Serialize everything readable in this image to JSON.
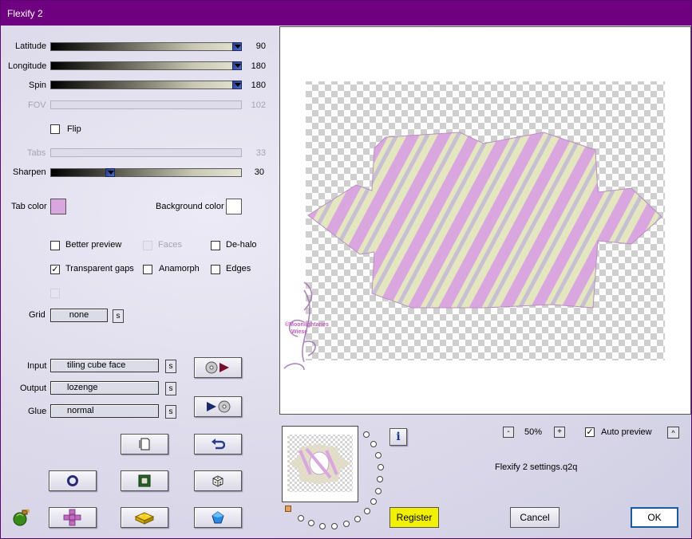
{
  "window": {
    "title": "Flexify 2"
  },
  "sliders": [
    {
      "label": "Latitude",
      "value": "90",
      "disabled": false,
      "level": 1.0
    },
    {
      "label": "Longitude",
      "value": "180",
      "disabled": false,
      "level": 1.0
    },
    {
      "label": "Spin",
      "value": "180",
      "disabled": false,
      "level": 1.0
    },
    {
      "label": "FOV",
      "value": "102",
      "disabled": true,
      "level": 0
    }
  ],
  "flip": {
    "label": "Flip",
    "checked": false
  },
  "tabs": {
    "label": "Tabs",
    "value": "33",
    "disabled": true
  },
  "sharpen": {
    "label": "Sharpen",
    "value": "30",
    "level": 0.3
  },
  "colors": {
    "tab_color_label": "Tab color",
    "tab_color": "#d9a6e0",
    "background_label": "Background color",
    "background_color": "#ffffff"
  },
  "options": {
    "better_preview": {
      "label": "Better preview",
      "checked": false
    },
    "faces": {
      "label": "Faces",
      "checked": false,
      "disabled": true
    },
    "de_halo": {
      "label": "De-halo",
      "checked": false
    },
    "transparent_gaps": {
      "label": "Transparent gaps",
      "checked": true
    },
    "anamorph": {
      "label": "Anamorph",
      "checked": false
    },
    "edges": {
      "label": "Edges",
      "checked": false
    }
  },
  "grid": {
    "label": "Grid",
    "value": "none",
    "s_label": "s"
  },
  "projection": {
    "input_label": "Input",
    "input_value": "tiling cube face",
    "output_label": "Output",
    "output_value": "lozenge",
    "glue_label": "Glue",
    "glue_value": "normal",
    "s_label": "s"
  },
  "preview": {
    "zoom_minus": "-",
    "zoom": "50%",
    "zoom_plus": "+",
    "auto_preview_label": "Auto preview",
    "auto_preview_checked": true,
    "collapse_label": "^",
    "info_label": "i",
    "settings_file": "Flexify 2 settings.q2q",
    "watermark_line1": "©Moonlightaries",
    "watermark_line2": "Wiese"
  },
  "buttons": {
    "register": "Register",
    "cancel": "Cancel",
    "ok": "OK"
  },
  "palette": {
    "accent": "#6f0080",
    "register_bg": "#f0f000",
    "pattern_pink": "#d9a6e0",
    "pattern_cream": "#e4e6c0"
  }
}
